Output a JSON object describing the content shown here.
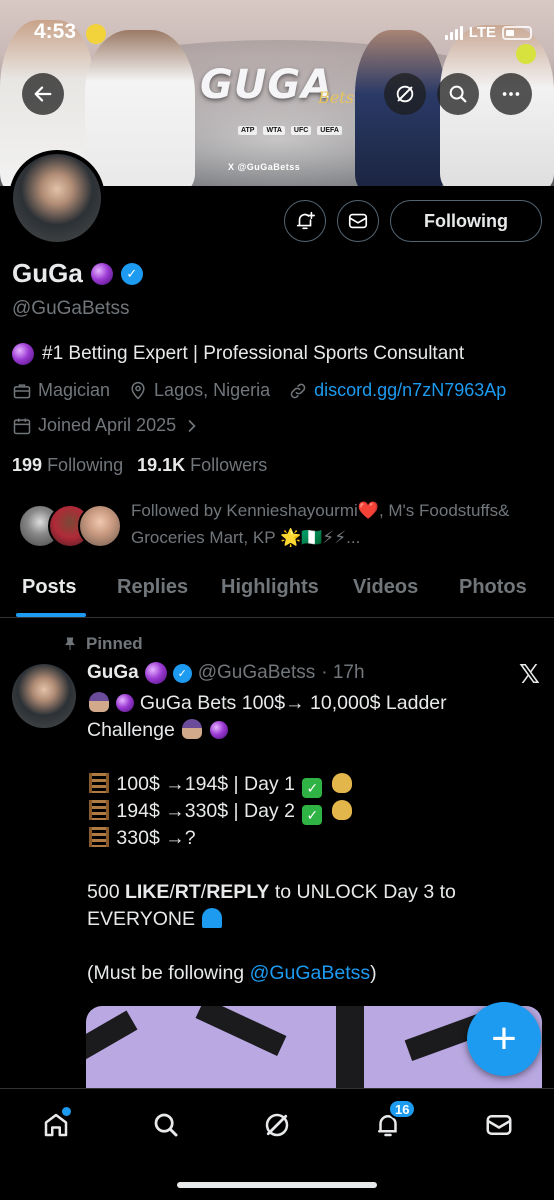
{
  "status_bar": {
    "time": "4:53",
    "network": "LTE"
  },
  "banner": {
    "logo_text": "GUGA",
    "logo_sub": "Bets",
    "sponsors": [
      "ATP",
      "WTA",
      "UFC",
      "UEFA"
    ],
    "handle": "X @GuGaBetss"
  },
  "header_actions": {
    "back_icon": "back-arrow-icon",
    "grok_icon": "grok-icon",
    "search_icon": "search-icon",
    "more_icon": "more-icon"
  },
  "profile": {
    "name": "GuGa",
    "handle": "@GuGaBetss",
    "bio": "#1 Betting Expert | Professional Sports Consultant",
    "profession": "Magician",
    "location": "Lagos, Nigeria",
    "link": "discord.gg/n7zN7963Ap",
    "joined": "Joined April 2025",
    "following_count": "199",
    "following_label": "Following",
    "followers_count": "19.1K",
    "followers_label": "Followers",
    "followed_by": "Followed by Kennieshayourmi❤️, M's Foodstuffs& Groceries Mart, KP 🌟🇳🇬⚡⚡...",
    "following_button": "Following",
    "accent_color": "#1d9bf0"
  },
  "tabs": [
    "Posts",
    "Replies",
    "Highlights",
    "Videos",
    "Photos"
  ],
  "post": {
    "pinned_label": "Pinned",
    "author_name": "GuGa",
    "author_handle": "@GuGaBetss",
    "time": "· 17h",
    "line1": "GuGa Bets 100$→ 10,000$ Ladder",
    "line1b": "Challenge",
    "day1": "100$ →194$ | Day 1",
    "day2": "194$ →330$ | Day 2",
    "day3": "330$ →?",
    "unlock_pre": "500 ",
    "unlock_like": "LIKE",
    "unlock_slash1": "/",
    "unlock_rt": "RT",
    "unlock_slash2": "/",
    "unlock_reply": "REPLY",
    "unlock_post": " to UNLOCK Day 3 to",
    "unlock_everyone": "EVERYONE",
    "must_follow_pre": "(Must be following ",
    "must_follow_mention": "@GuGaBetss",
    "must_follow_post": ")"
  },
  "bottom_nav": {
    "items": [
      "home-icon",
      "search-icon",
      "grok-icon",
      "notifications-icon",
      "messages-icon"
    ],
    "notification_badge": "16"
  },
  "fab_label": "+"
}
